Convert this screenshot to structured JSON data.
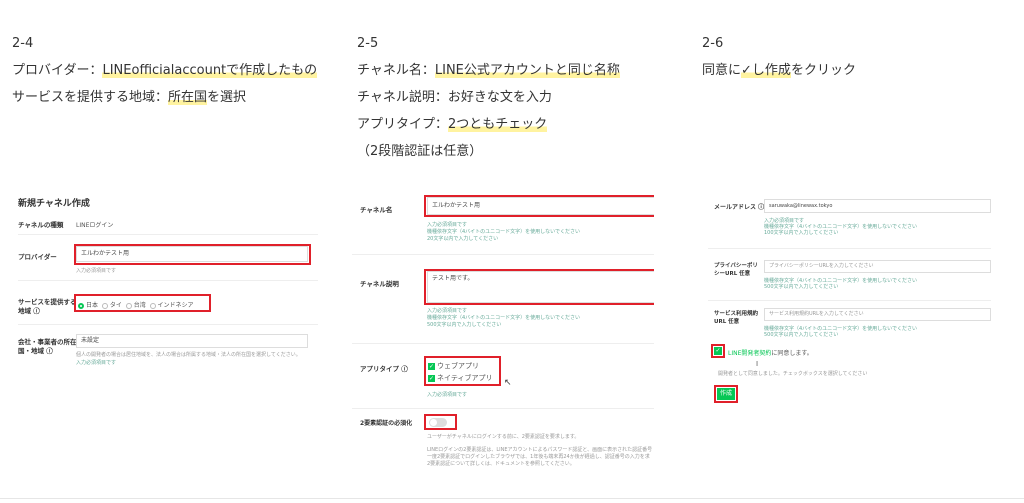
{
  "col1": {
    "step": "2-4",
    "line1_pre": "プロバイダー：",
    "line1_hl": "LINEofficialaccountで作成したもの",
    "line2_pre": "サービスを提供する地域：",
    "line2_hl": "所在国",
    "line2_post": "を選択"
  },
  "col2": {
    "step": "2-5",
    "line1_pre": "チャネル名：",
    "line1_hl": "LINE公式アカウントと同じ名称",
    "line2": "チャネル説明：お好きな文を入力",
    "line3_pre": "アプリタイプ：",
    "line3_hl": "2つともチェック",
    "line4": "（2段階認証は任意）"
  },
  "col3": {
    "step": "2-6",
    "line1_pre": "同意に",
    "line1_hl1": "✓し",
    "line1_hl2": "作成",
    "line1_post": "をクリック"
  },
  "shot1": {
    "title": "新規チャネル作成",
    "type_label": "チャネルの種類",
    "type_value": "LINEログイン",
    "provider_label": "プロバイダー",
    "provider_value": "エルわかテスト用",
    "provider_hint": "入力必須項目です",
    "region_label": "サービスを提供する地域 ⓘ",
    "regions": [
      "日本",
      "タイ",
      "台湾",
      "インドネシア"
    ],
    "company_label": "会社・事業者の所在国・地域 ⓘ",
    "company_value": "未設定",
    "company_hint": "個人の開発者の場合は居住地域を、法人の場合は所属する地域・法人の所在国を選択してください。",
    "company_hint2": "入力必須項目です"
  },
  "shot2": {
    "name_label": "チャネル名",
    "name_value": "エルわかテスト用",
    "name_hints": [
      "入力必須項目です",
      "機種依存文字（4バイトのユニコード文字）を使用しないでください",
      "20文字以内で入力してください"
    ],
    "desc_label": "チャネル説明",
    "desc_value": "テスト用です。",
    "desc_hints": [
      "入力必須項目です",
      "機種依存文字（4バイトのユニコード文字）を使用しないでください",
      "500文字以内で入力してください"
    ],
    "app_label": "アプリタイプ ⓘ",
    "app_options": [
      "ウェブアプリ",
      "ネイティブアプリ"
    ],
    "app_hint": "入力必須項目です",
    "twofa_label": "2要素認証の必須化",
    "twofa_hint": "ユーザーがチャネルにログインする前に、2要素認証を要求します。",
    "twofa_notes": [
      "LINEログインの2要素認証は、LINEアカウントによるパスワード認証と、画面に表示された認証番号",
      "一度2要素認証でログインしたブラウザでは、1年後も端末再24か後が経過し、認証番号の入力を求",
      "2要素認証について詳しくは、ドキュメントを参照してください。"
    ]
  },
  "shot3": {
    "email_label": "メールアドレス ⓘ",
    "email_value": "saruwaka@linewax.tokyo",
    "email_hints": [
      "入力必須項目です",
      "機種依存文字（4バイトのユニコード文字）を使用しないでください",
      "100文字以内で入力してください"
    ],
    "privacy_label": "プライバシーポリシーURL 任意",
    "privacy_placeholder": "プライバシーポリシーURLを入力してください",
    "privacy_hints": [
      "機種依存文字（4バイトのユニコード文字）を使用しないでください",
      "500文字以内で入力してください"
    ],
    "terms_label": "サービス利用規約URL 任意",
    "terms_placeholder": "サービス利用規約URLを入力してください",
    "terms_hints": [
      "機種依存文字（4バイトのユニコード文字）を使用しないでください",
      "500文字以内で入力してください"
    ],
    "agree_link": "LINE開発者契約",
    "agree_text": "に同意します。",
    "agree_hint": "開発者として同意しました。チェックボックスを選択してください",
    "create_button": "作成"
  },
  "colors": {
    "highlight": "#fff3a0",
    "annotation_red": "#e0202a",
    "line_green": "#06c755"
  }
}
